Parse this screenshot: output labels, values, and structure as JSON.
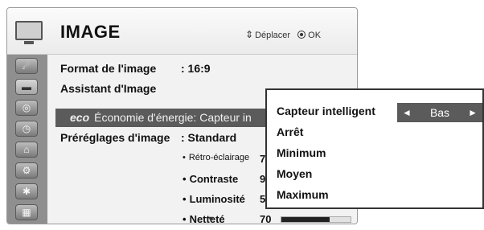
{
  "header": {
    "title": "IMAGE",
    "hint_nav_icon": "4-way-arrows-icon",
    "hint_move_label": "Déplacer",
    "hint_ok_icon": "ok-button-icon",
    "hint_ok_label": "OK"
  },
  "sidebar": {
    "items": [
      {
        "icon": "satellite-dish-icon",
        "glyph": "☄"
      },
      {
        "icon": "tv-screen-icon",
        "glyph": "▬"
      },
      {
        "icon": "speaker-icon",
        "glyph": "◎"
      },
      {
        "icon": "clock-icon",
        "glyph": "◷"
      },
      {
        "icon": "lock-icon",
        "glyph": "⌂"
      },
      {
        "icon": "options-icon",
        "glyph": "⚙"
      },
      {
        "icon": "usb-icon",
        "glyph": "✱"
      },
      {
        "icon": "film-icon",
        "glyph": "▦"
      }
    ],
    "active_index": 1
  },
  "rows": {
    "format_label": "Format de l'image",
    "format_value": ": 16:9",
    "assistant_label": "Assistant d'Image",
    "eco_icon_text": "eco",
    "eco_label": "Économie d'énergie: Capteur in",
    "preset_label": "Préréglages d'image",
    "preset_value": ": Standard"
  },
  "sub_settings": [
    {
      "label": "Rétro-éclairage",
      "value": "7",
      "small": true
    },
    {
      "label": "Contraste",
      "value": "9",
      "small": false
    },
    {
      "label": "Luminosité",
      "value": "5",
      "small": false
    },
    {
      "label": "Netteté",
      "value": "70",
      "small": false,
      "level": 0.7
    }
  ],
  "popup": {
    "options": [
      "Capteur intelligent",
      "Arrêt",
      "Minimum",
      "Moyen",
      "Maximum"
    ],
    "selector_value": "Bas",
    "left_arrow": "◄",
    "right_arrow": "►"
  },
  "colors": {
    "highlight": "#5b5b5b",
    "sidebar": "#8f8f8f"
  }
}
